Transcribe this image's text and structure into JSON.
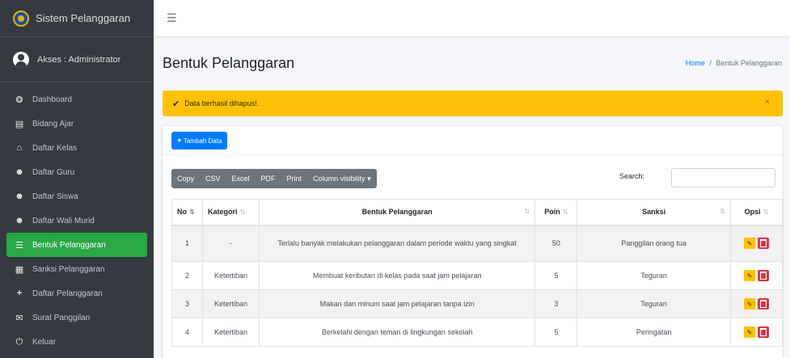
{
  "sidebar": {
    "brand": "Sistem Pelanggaran",
    "user": "Akses : Administrator",
    "items": [
      {
        "icon": "dashboard-icon",
        "label": "Dashboard"
      },
      {
        "icon": "book-icon",
        "label": "Bidang Ajar"
      },
      {
        "icon": "building-icon",
        "label": "Daftar Kelas"
      },
      {
        "icon": "users-icon",
        "label": "Daftar Guru"
      },
      {
        "icon": "users-icon",
        "label": "Daftar Siswa"
      },
      {
        "icon": "users-icon",
        "label": "Daftar Wali Murid"
      },
      {
        "icon": "list-icon",
        "label": "Bentuk Pelanggaran"
      },
      {
        "icon": "table-icon",
        "label": "Sanksi Pelanggaran"
      },
      {
        "icon": "plus-icon",
        "label": "Daftar Pelanggaran"
      },
      {
        "icon": "mail-icon",
        "label": "Surat Panggilan"
      },
      {
        "icon": "power-icon",
        "label": "Keluar"
      }
    ]
  },
  "header": {
    "menu_icon": "hamburger-icon",
    "title": "Bentuk Pelanggaran",
    "breadcrumb_home": "Home",
    "breadcrumb_sep": "/",
    "breadcrumb_current": "Bentuk Pelanggaran"
  },
  "alert": {
    "text": "Data berhasil dihapus!.",
    "close": "×",
    "color": "#ffc107"
  },
  "card": {
    "add_button": "Tambah Data",
    "export_buttons": [
      "Copy",
      "CSV",
      "Excel",
      "PDF",
      "Print",
      "Column visibility ▾"
    ],
    "search_label": "Search:",
    "search_value": ""
  },
  "table": {
    "headers": [
      "No",
      "Kategori",
      "Bentuk Pelanggaran",
      "Poin",
      "Sanksi",
      "Opsi"
    ],
    "rows": [
      {
        "no": "1",
        "kategori": "-",
        "bentuk": "Terlalu banyak melakukan pelanggaran dalam periode waktu yang singkat",
        "poin": "50",
        "sanksi": "Panggilan orang tua"
      },
      {
        "no": "2",
        "kategori": "Ketertiban",
        "bentuk": "Membuat keributan di kelas pada saat jam pelajaran",
        "poin": "5",
        "sanksi": "Teguran"
      },
      {
        "no": "3",
        "kategori": "Ketertiban",
        "bentuk": "Makan dan minum saat jam pelajaran tanpa izin",
        "poin": "3",
        "sanksi": "Teguran"
      },
      {
        "no": "4",
        "kategori": "Ketertiban",
        "bentuk": "Berkelahi dengan teman di lingkungan sekolah",
        "poin": "5",
        "sanksi": "Peringatan"
      }
    ]
  },
  "colors": {
    "sidebar": "#343a40",
    "active": "#28a745",
    "primary": "#007bff",
    "danger": "#dc3545",
    "warning": "#ffc107"
  }
}
